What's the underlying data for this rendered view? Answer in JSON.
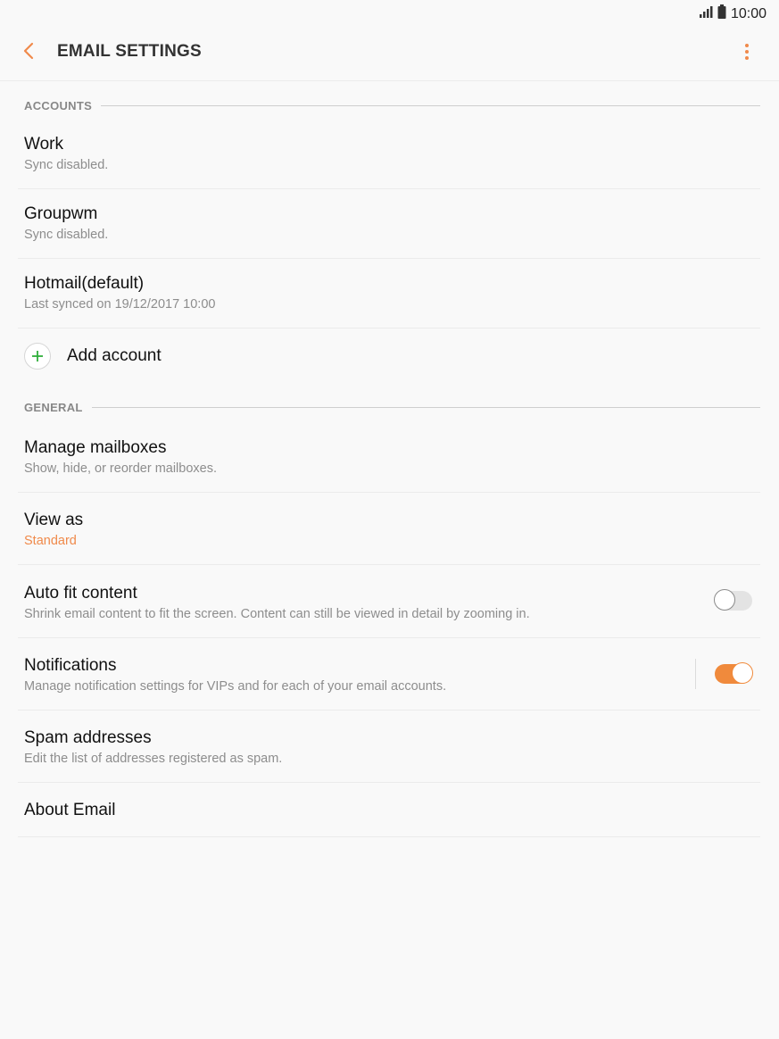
{
  "status_bar": {
    "time": "10:00",
    "signal_icon": "signal-bars-icon",
    "battery_icon": "battery-icon"
  },
  "app_bar": {
    "title": "EMAIL SETTINGS",
    "back_icon": "chevron-left-icon",
    "more_icon": "more-vertical-icon"
  },
  "colors": {
    "accent": "#f08a3c",
    "add_green": "#2fae3a",
    "background": "#f9f9f9"
  },
  "accounts": {
    "header": "ACCOUNTS",
    "items": [
      {
        "title": "Work",
        "subtitle": "Sync disabled."
      },
      {
        "title": "Groupwm",
        "subtitle": "Sync disabled."
      },
      {
        "title": "Hotmail(default)",
        "subtitle": "Last synced on 19/12/2017  10:00"
      }
    ],
    "add_label": "Add account",
    "add_icon": "plus-icon"
  },
  "general": {
    "header": "GENERAL",
    "items": [
      {
        "title": "Manage mailboxes",
        "subtitle": "Show, hide, or reorder mailboxes."
      },
      {
        "title": "View as",
        "subtitle": "Standard"
      },
      {
        "title": "Auto fit content",
        "subtitle": "Shrink email content to fit the screen. Content can still be viewed in detail by zooming in.",
        "toggle": "off"
      },
      {
        "title": "Notifications",
        "subtitle": "Manage notification settings for VIPs and for each of your email accounts.",
        "toggle": "on"
      },
      {
        "title": "Spam addresses",
        "subtitle": "Edit the list of addresses registered as spam."
      },
      {
        "title": "About Email"
      }
    ]
  }
}
